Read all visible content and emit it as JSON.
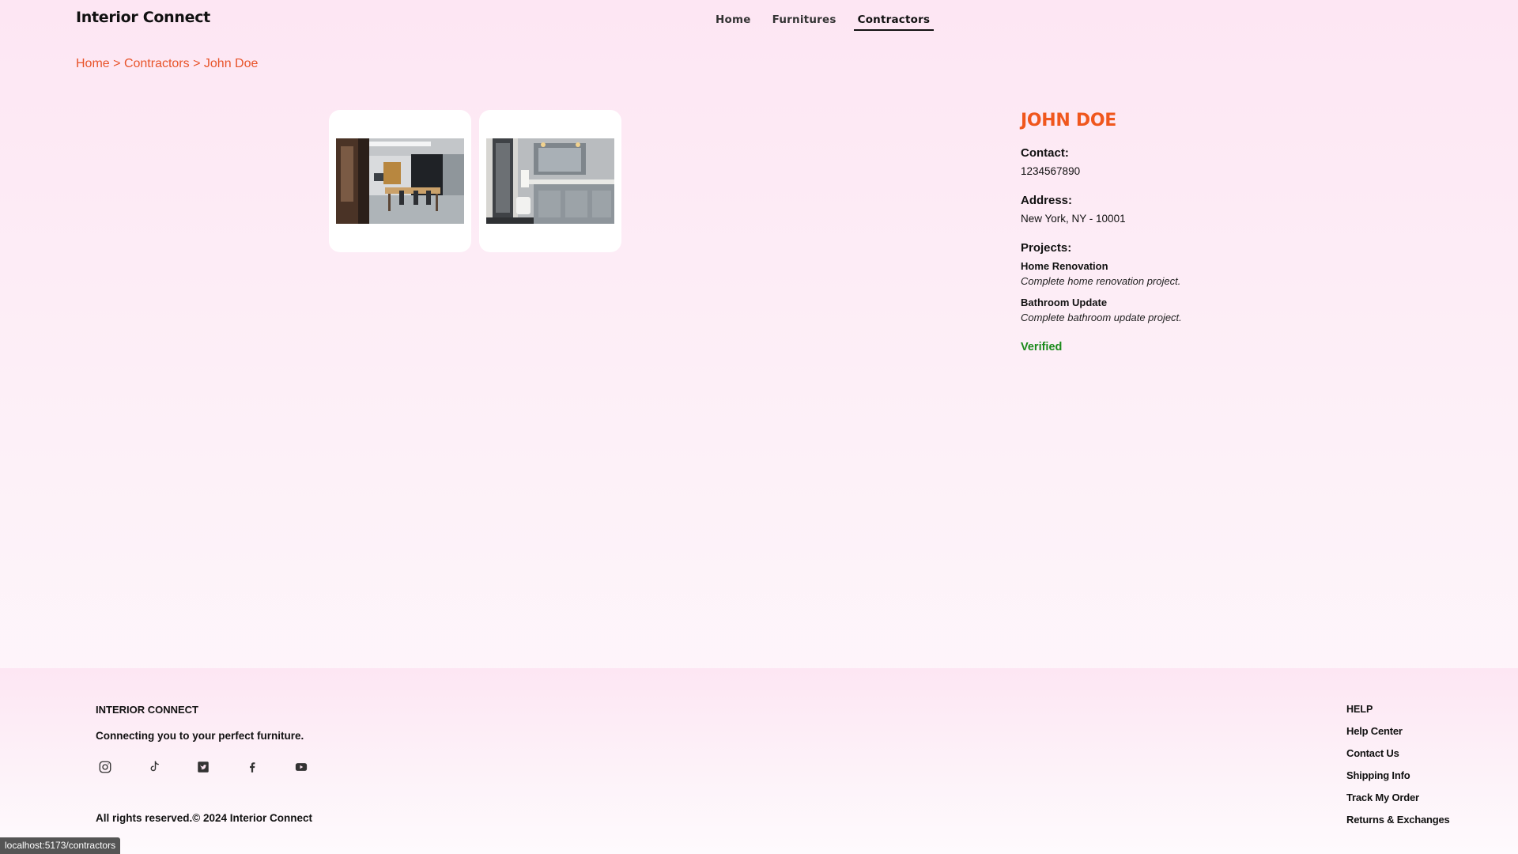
{
  "header": {
    "brand": "Interior Connect",
    "nav": [
      {
        "label": "Home"
      },
      {
        "label": "Furnitures"
      },
      {
        "label": "Contractors"
      }
    ]
  },
  "breadcrumb": {
    "items": [
      "Home",
      "Contractors",
      "John Doe"
    ],
    "separator": ">"
  },
  "contractor": {
    "name": "JOHN DOE",
    "contact_label": "Contact:",
    "contact": "1234567890",
    "address_label": "Address:",
    "address": "New York, NY - 10001",
    "projects_label": "Projects:",
    "projects": [
      {
        "title": "Home Renovation",
        "description": "Complete home renovation project."
      },
      {
        "title": "Bathroom Update",
        "description": "Complete bathroom update project."
      }
    ],
    "status": "Verified"
  },
  "footer": {
    "brand": "INTERIOR CONNECT",
    "tagline": "Connecting you to your perfect furniture.",
    "socials": [
      "instagram-icon",
      "tiktok-icon",
      "twitter-icon",
      "facebook-icon",
      "youtube-icon"
    ],
    "copyright": "All rights reserved.© 2024 Interior Connect",
    "help_title": "HELP",
    "help_links": [
      "Help Center",
      "Contact Us",
      "Shipping Info",
      "Track My Order",
      "Returns & Exchanges"
    ]
  },
  "status_bar": "localhost:5173/contractors",
  "colors": {
    "accent": "#f0571d",
    "breadcrumb": "#e8542a",
    "verified": "#1a8a1a"
  }
}
